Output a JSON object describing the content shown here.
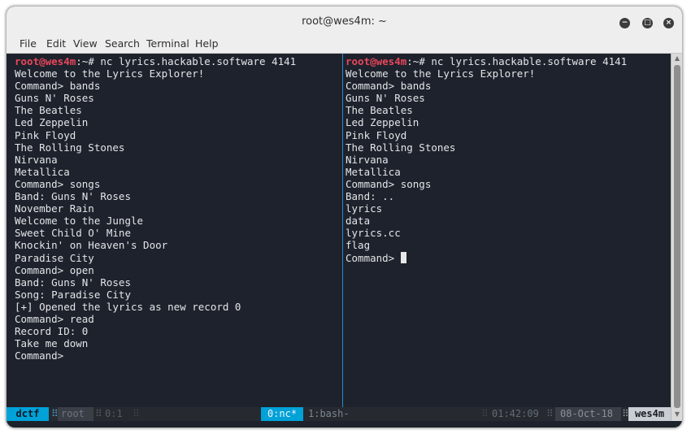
{
  "window": {
    "title": "root@wes4m: ~",
    "buttons": {
      "minimize": "−",
      "maximize": "□",
      "close": "×"
    }
  },
  "menu": [
    "File",
    "Edit",
    "View",
    "Search",
    "Terminal",
    "Help"
  ],
  "prompt": {
    "user": "root@wes4m",
    "suffix": ":~# ",
    "command": "nc lyrics.hackable.software 4141"
  },
  "left_pane": {
    "lines": [
      "Welcome to the Lyrics Explorer!",
      "Command> bands",
      "Guns N' Roses",
      "The Beatles",
      "Led Zeppelin",
      "Pink Floyd",
      "The Rolling Stones",
      "Nirvana",
      "Metallica",
      "Command> songs",
      "Band: Guns N' Roses",
      "November Rain",
      "Welcome to the Jungle",
      "Sweet Child O' Mine",
      "Knockin' on Heaven's Door",
      "Paradise City",
      "Command> open",
      "Band: Guns N' Roses",
      "Song: Paradise City",
      "[+] Opened the lyrics as new record 0",
      "Command> read",
      "Record ID: 0",
      "Take me down",
      "Command> "
    ]
  },
  "right_pane": {
    "lines": [
      "Welcome to the Lyrics Explorer!",
      "Command> bands",
      "Guns N' Roses",
      "The Beatles",
      "Led Zeppelin",
      "Pink Floyd",
      "The Rolling Stones",
      "Nirvana",
      "Metallica",
      "Command> songs",
      "Band: ..",
      "lyrics",
      "data",
      "lyrics.cc",
      "flag"
    ],
    "current_input": "Command> "
  },
  "statusbar": {
    "session": "dctf",
    "user_sep": "⠿",
    "user": "root",
    "pane_sep": "⠿",
    "pane_index": "0:1",
    "pane_sep2": "⠿",
    "window_active": "0:nc*",
    "window_other": "1:bash-",
    "time_sep": "⠿",
    "time": "01:42:09",
    "date_sep": "⠿",
    "date": "08-Oct-18",
    "host_sep": "⠿",
    "host": "wes4m"
  },
  "colors": {
    "terminal_bg": "#1e222c",
    "prompt": "#e8475b",
    "text": "#e3e5e8",
    "status_active": "#00a2d8",
    "divider": "#2b8bc9"
  }
}
